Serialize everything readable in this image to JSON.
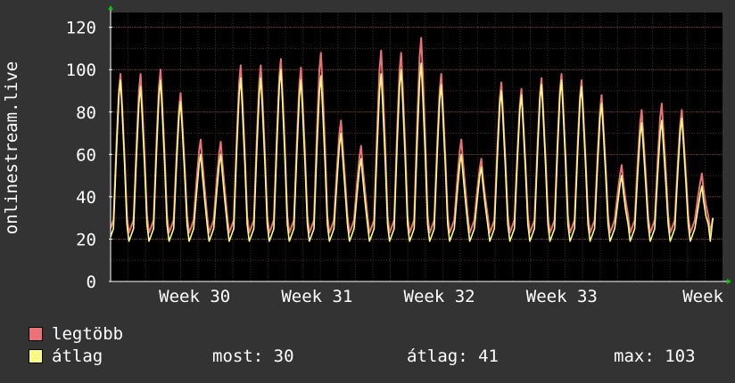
{
  "chart_data": {
    "type": "line",
    "ylabel": "onlinestream.live",
    "ylim": [
      0,
      127
    ],
    "yticks": [
      0,
      20,
      40,
      60,
      80,
      100,
      120
    ],
    "x_tick_labels": [
      "Week 30",
      "Week 31",
      "Week 32",
      "Week 33",
      "Week"
    ],
    "x_days": 35,
    "grid": true,
    "series": [
      {
        "name": "legtöbb",
        "color": "#ea7274",
        "daily_peaks": [
          98,
          98,
          100,
          89,
          67,
          66,
          102,
          102,
          105,
          101,
          108,
          76,
          64,
          109,
          108,
          115,
          98,
          67,
          58,
          94,
          91,
          96,
          98,
          95,
          88,
          55,
          81,
          84,
          81,
          51
        ],
        "baseline": 21
      },
      {
        "name": "átlag",
        "color": "#fdfd85",
        "daily_peaks": [
          95,
          92,
          95,
          85,
          60,
          60,
          96,
          96,
          100,
          95,
          97,
          70,
          58,
          98,
          100,
          103,
          93,
          60,
          54,
          90,
          88,
          93,
          95,
          92,
          84,
          50,
          75,
          76,
          77,
          45
        ],
        "baseline": 17
      }
    ]
  },
  "legend": {
    "items": [
      {
        "label": "legtöbb",
        "color": "#ea7274"
      },
      {
        "label": "átlag",
        "color": "#fdfd85"
      }
    ],
    "now": "most: 30",
    "avg": "átlag: 41",
    "max": "max: 103"
  }
}
